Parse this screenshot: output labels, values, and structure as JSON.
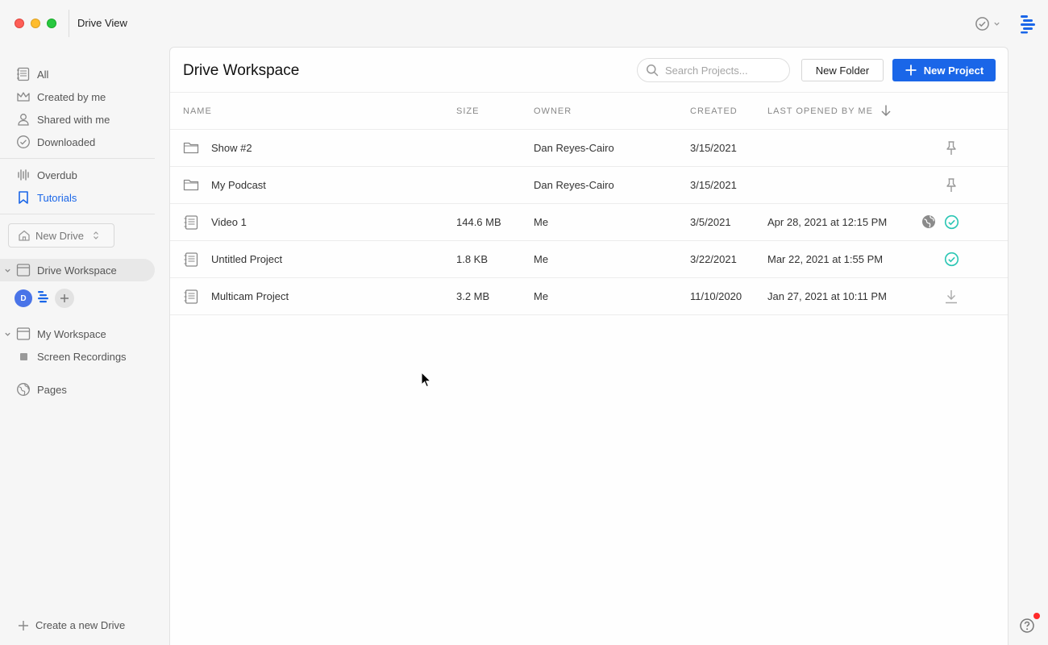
{
  "window": {
    "title": "Drive View"
  },
  "sidebar": {
    "items": [
      {
        "label": "All",
        "icon": "project-icon"
      },
      {
        "label": "Created by me",
        "icon": "crown-icon"
      },
      {
        "label": "Shared with me",
        "icon": "person-icon"
      },
      {
        "label": "Downloaded",
        "icon": "check-circle-icon"
      }
    ],
    "tools": [
      {
        "label": "Overdub",
        "icon": "waveform-icon"
      },
      {
        "label": "Tutorials",
        "icon": "bookmark-icon",
        "active": true
      }
    ],
    "drive_select": {
      "label": "New Drive"
    },
    "workspaces": [
      {
        "label": "Drive Workspace",
        "selected": true
      },
      {
        "label": "My Workspace"
      }
    ],
    "members": {
      "avatar_initial": "D"
    },
    "sub_items": [
      {
        "label": "Screen Recordings"
      }
    ],
    "pages": {
      "label": "Pages"
    },
    "create_drive": {
      "label": "Create a new Drive"
    }
  },
  "main": {
    "title": "Drive Workspace",
    "search": {
      "placeholder": "Search Projects...",
      "value": ""
    },
    "buttons": {
      "new_folder": "New Folder",
      "new_project": "New Project"
    },
    "columns": {
      "name": "NAME",
      "size": "SIZE",
      "owner": "OWNER",
      "created": "CREATED",
      "last_opened": "LAST OPENED BY ME"
    },
    "rows": [
      {
        "type": "folder",
        "name": "Show #2",
        "size": "",
        "owner": "Dan Reyes-Cairo",
        "created": "3/15/2021",
        "last_opened": "",
        "actions": [
          "pin"
        ]
      },
      {
        "type": "folder",
        "name": "My Podcast",
        "size": "",
        "owner": "Dan Reyes-Cairo",
        "created": "3/15/2021",
        "last_opened": "",
        "actions": [
          "pin"
        ]
      },
      {
        "type": "project",
        "name": "Video 1",
        "size": "144.6 MB",
        "owner": "Me",
        "created": "3/5/2021",
        "last_opened": "Apr 28, 2021 at 12:15 PM",
        "actions": [
          "published",
          "synced"
        ]
      },
      {
        "type": "project",
        "name": "Untitled Project",
        "size": "1.8 KB",
        "owner": "Me",
        "created": "3/22/2021",
        "last_opened": "Mar 22, 2021 at 1:55 PM",
        "actions": [
          "synced"
        ]
      },
      {
        "type": "project",
        "name": "Multicam Project",
        "size": "3.2 MB",
        "owner": "Me",
        "created": "11/10/2020",
        "last_opened": "Jan 27, 2021 at 10:11 PM",
        "actions": [
          "download"
        ]
      }
    ]
  },
  "colors": {
    "accent": "#1a66e8",
    "synced": "#2bc6b4",
    "notification": "#ff2a2a"
  }
}
